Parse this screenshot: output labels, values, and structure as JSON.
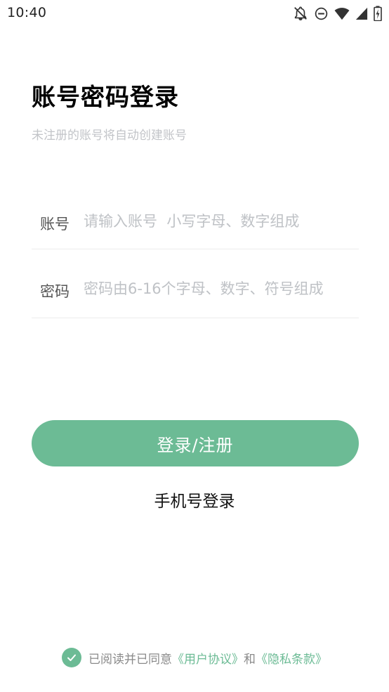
{
  "status_bar": {
    "time": "10:40",
    "icons": [
      "notifications-off-icon",
      "do-not-disturb-icon",
      "wifi-icon",
      "signal-icon",
      "battery-icon"
    ]
  },
  "header": {
    "title": "账号密码登录",
    "subtitle": "未注册的账号将自动创建账号"
  },
  "form": {
    "account": {
      "label": "账号",
      "value": "",
      "placeholder": "请输入账号  小写字母、数字组成"
    },
    "password": {
      "label": "密码",
      "value": "",
      "placeholder": "密码由6-16个字母、数字、符号组成"
    }
  },
  "actions": {
    "login_label": "登录/注册",
    "phone_login_label": "手机号登录"
  },
  "agreement": {
    "checked": true,
    "prefix": "已阅读并已同意",
    "user_agreement": "《用户协议》",
    "and": "和",
    "privacy_policy": "《隐私条款》"
  },
  "colors": {
    "accent": "#6cbb95",
    "placeholder": "#bfc2c6",
    "subtitle": "#c2c4c8"
  }
}
